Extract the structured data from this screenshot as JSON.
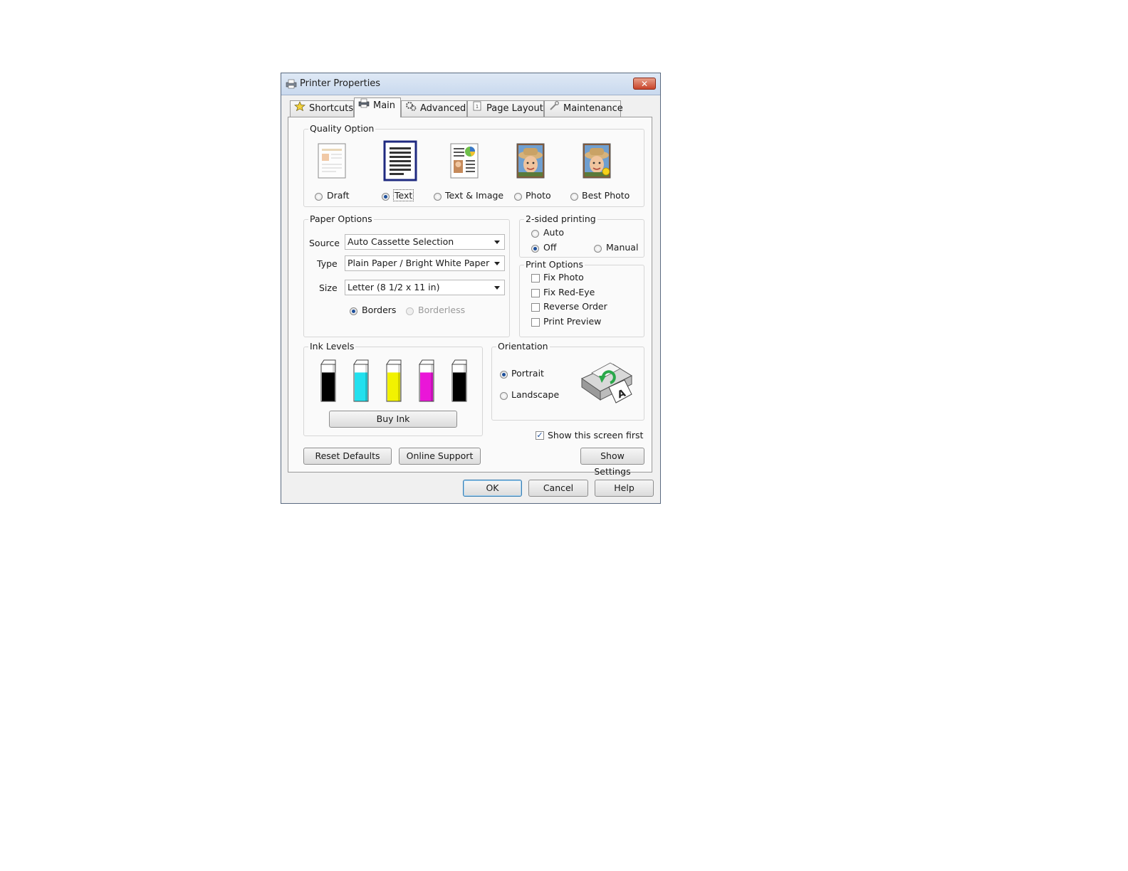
{
  "window": {
    "title": "Printer Properties",
    "close_symbol": "✕"
  },
  "tabs": [
    {
      "label": "Shortcuts",
      "icon": "star-icon",
      "active": false
    },
    {
      "label": "Main",
      "icon": "printer-icon",
      "active": true
    },
    {
      "label": "Advanced",
      "icon": "gears-icon",
      "active": false
    },
    {
      "label": "Page Layout",
      "icon": "page-icon",
      "active": false
    },
    {
      "label": "Maintenance",
      "icon": "wrench-icon",
      "active": false
    }
  ],
  "quality": {
    "group_label": "Quality Option",
    "options": [
      {
        "label": "Draft",
        "selected": false,
        "icon": "draft-page-icon"
      },
      {
        "label": "Text",
        "selected": true,
        "icon": "text-page-icon"
      },
      {
        "label": "Text & Image",
        "selected": false,
        "icon": "text-image-page-icon"
      },
      {
        "label": "Photo",
        "selected": false,
        "icon": "photo-icon"
      },
      {
        "label": "Best Photo",
        "selected": false,
        "icon": "best-photo-icon"
      }
    ]
  },
  "paper": {
    "group_label": "Paper Options",
    "source_label": "Source",
    "source_value": "Auto Cassette Selection",
    "type_label": "Type",
    "type_value": "Plain Paper / Bright White Paper",
    "size_label": "Size",
    "size_value": "Letter (8 1/2 x 11 in)",
    "borders_label": "Borders",
    "borderless_label": "Borderless",
    "borders_selected": true,
    "borderless_enabled": false
  },
  "duplex": {
    "group_label": "2-sided printing",
    "auto_label": "Auto",
    "off_label": "Off",
    "manual_label": "Manual",
    "selected": "Off"
  },
  "print_options": {
    "group_label": "Print Options",
    "items": [
      {
        "label": "Fix Photo",
        "checked": false
      },
      {
        "label": "Fix Red-Eye",
        "checked": false
      },
      {
        "label": "Reverse Order",
        "checked": false
      },
      {
        "label": "Print Preview",
        "checked": false
      }
    ]
  },
  "ink": {
    "group_label": "Ink Levels",
    "cartridges": [
      {
        "color": "#000000",
        "level": 0.78
      },
      {
        "color": "#22e0ee",
        "level": 0.78
      },
      {
        "color": "#f2f200",
        "level": 0.78
      },
      {
        "color": "#ea16d8",
        "level": 0.78
      },
      {
        "color": "#000000",
        "level": 0.78
      }
    ],
    "buy_label": "Buy Ink"
  },
  "orientation": {
    "group_label": "Orientation",
    "portrait_label": "Portrait",
    "landscape_label": "Landscape",
    "selected": "Portrait"
  },
  "show_screen_first": {
    "label": "Show this screen first",
    "checked": true,
    "check_glyph": "✓"
  },
  "buttons": {
    "reset": "Reset Defaults",
    "online_support": "Online Support",
    "show_settings": "Show Settings",
    "ok": "OK",
    "cancel": "Cancel",
    "help": "Help"
  }
}
